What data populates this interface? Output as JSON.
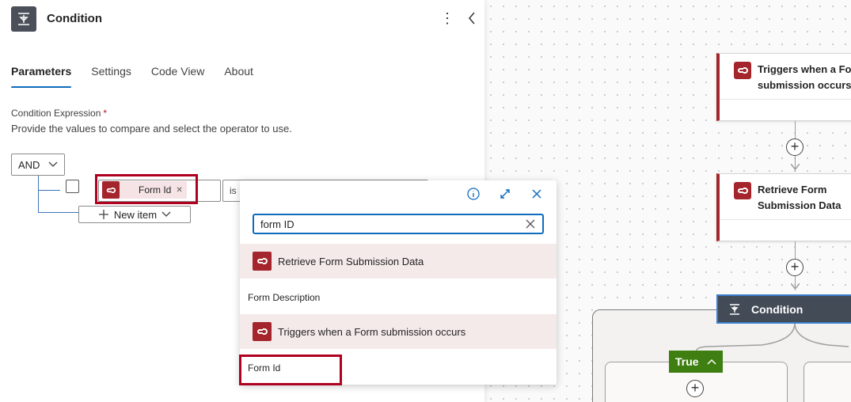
{
  "panel": {
    "title": "Condition",
    "more_icon": "more-vertical-icon",
    "collapse_icon": "chevron-left-icon",
    "tabs": [
      {
        "label": "Parameters",
        "active": true
      },
      {
        "label": "Settings",
        "active": false
      },
      {
        "label": "Code View",
        "active": false
      },
      {
        "label": "About",
        "active": false
      }
    ],
    "field_label": "Condition Expression",
    "required_mark": "*",
    "field_description": "Provide the values to compare and select the operator to use.",
    "group_operator": "AND",
    "row": {
      "token_label": "Form Id",
      "operator_partial": "is"
    },
    "new_item_label": "New item"
  },
  "picker": {
    "search_value": "form ID",
    "groups": [
      {
        "label": "Retrieve Form Submission Data",
        "items": [
          "Form Description"
        ]
      },
      {
        "label": "Triggers when a Form submission occurs",
        "items": [
          "Form Id"
        ]
      }
    ]
  },
  "canvas": {
    "cards": [
      {
        "label_line1": "Triggers when a Fo",
        "label_line2": "submission occurs"
      },
      {
        "label_line1": "Retrieve Form",
        "label_line2": "Submission Data"
      }
    ],
    "condition_label": "Condition",
    "true_label": "True"
  },
  "colors": {
    "accent": "#0f6cbd",
    "connector_red": "#a4262c",
    "highlight_red": "#b00020",
    "condition_dark": "#434b57",
    "true_green": "#3f7f12"
  }
}
